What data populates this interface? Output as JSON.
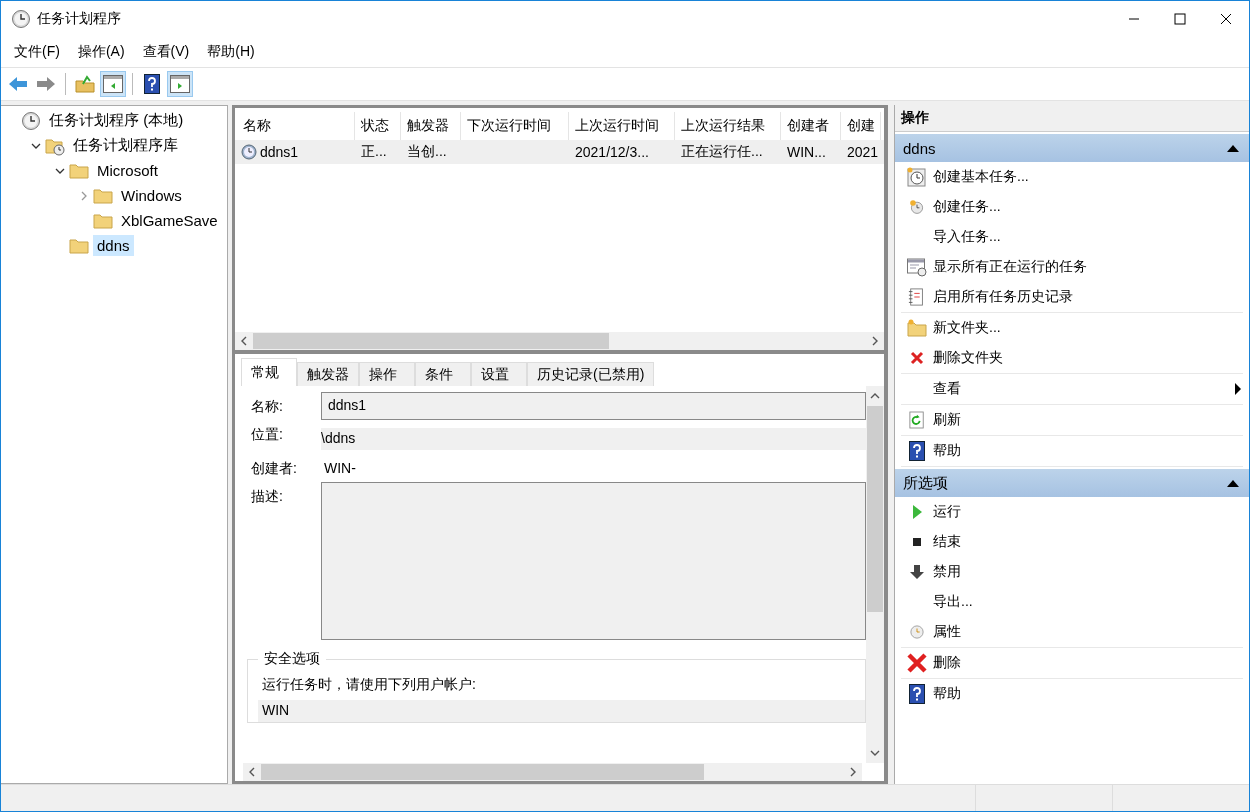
{
  "window": {
    "title": "任务计划程序"
  },
  "menu": [
    "文件(F)",
    "操作(A)",
    "查看(V)",
    "帮助(H)"
  ],
  "toolbar": [
    {
      "kind": "back",
      "selected": false
    },
    {
      "kind": "forward",
      "selected": false
    },
    {
      "kind": "up",
      "selected": false
    },
    {
      "kind": "console-tree",
      "selected": true
    },
    {
      "kind": "help",
      "selected": false
    },
    {
      "kind": "action-pane",
      "selected": true
    }
  ],
  "tree": [
    {
      "label": "任务计划程序 (本地)",
      "kind": "root",
      "selected": false,
      "children": [
        {
          "label": "任务计划程序库",
          "kind": "library",
          "expanded": true,
          "selected": false,
          "children": [
            {
              "label": "Microsoft",
              "kind": "folder",
              "expanded": true,
              "selected": false,
              "children": [
                {
                  "label": "Windows",
                  "kind": "folder",
                  "expanded": false,
                  "selected": false
                },
                {
                  "label": "XblGameSave",
                  "kind": "folder",
                  "selected": false
                }
              ]
            },
            {
              "label": "ddns",
              "kind": "folder",
              "selected": true
            }
          ]
        }
      ]
    }
  ],
  "table": {
    "columns": [
      "名称",
      "状态",
      "触发器",
      "下次运行时间",
      "上次运行时间",
      "上次运行结果",
      "创建者",
      "创建"
    ],
    "rows": [
      {
        "selected": true,
        "cells": [
          "ddns1",
          "正...",
          "当创...",
          "",
          "2021/12/3...",
          "正在运行任...",
          "WIN...",
          "2021"
        ]
      }
    ]
  },
  "details": {
    "tabs": [
      {
        "label": "常规",
        "selected": true
      },
      {
        "label": "触发器",
        "selected": false
      },
      {
        "label": "操作",
        "selected": false
      },
      {
        "label": "条件",
        "selected": false
      },
      {
        "label": "设置",
        "selected": false
      },
      {
        "label": "历史记录(已禁用)",
        "selected": false
      }
    ],
    "fields": [
      {
        "label": "名称:",
        "value": "ddns1",
        "kind": "input"
      },
      {
        "label": "位置:",
        "value": "\\ddns",
        "kind": "readonly"
      },
      {
        "label": "创建者:",
        "value": "WIN-",
        "kind": "plain"
      },
      {
        "label": "描述:",
        "kind": "textarea"
      }
    ],
    "security": {
      "title": "安全选项",
      "label": "运行任务时，请使用下列用户帐户:",
      "account": "WIN"
    }
  },
  "actions": {
    "title": "操作",
    "sections": [
      {
        "title": "ddns",
        "expanded": true,
        "groups": [
          {
            "items": [
              {
                "label": "创建基本任务...",
                "kind": "basic-task"
              },
              {
                "label": "创建任务...",
                "kind": "task"
              },
              {
                "label": "导入任务...",
                "kind": "none"
              },
              {
                "label": "显示所有正在运行的任务",
                "kind": "running"
              },
              {
                "label": "启用所有任务历史记录",
                "kind": "history"
              }
            ]
          },
          {
            "items": [
              {
                "label": "新文件夹...",
                "kind": "folder"
              },
              {
                "label": "删除文件夹",
                "kind": "delete-small"
              }
            ]
          },
          {
            "items": [
              {
                "label": "查看",
                "kind": "submenu"
              }
            ]
          },
          {
            "items": [
              {
                "label": "刷新",
                "kind": "refresh"
              }
            ]
          },
          {
            "items": [
              {
                "label": "帮助",
                "kind": "help"
              }
            ]
          }
        ]
      },
      {
        "title": "所选项",
        "expanded": true,
        "groups": [
          {
            "items": [
              {
                "label": "运行",
                "kind": "run"
              },
              {
                "label": "结束",
                "kind": "stop"
              },
              {
                "label": "禁用",
                "kind": "disable"
              },
              {
                "label": "导出...",
                "kind": "none"
              },
              {
                "label": "属性",
                "kind": "properties"
              }
            ]
          },
          {
            "items": [
              {
                "label": "删除",
                "kind": "delete"
              }
            ]
          },
          {
            "items": [
              {
                "label": "帮助",
                "kind": "help"
              }
            ]
          }
        ]
      }
    ]
  }
}
